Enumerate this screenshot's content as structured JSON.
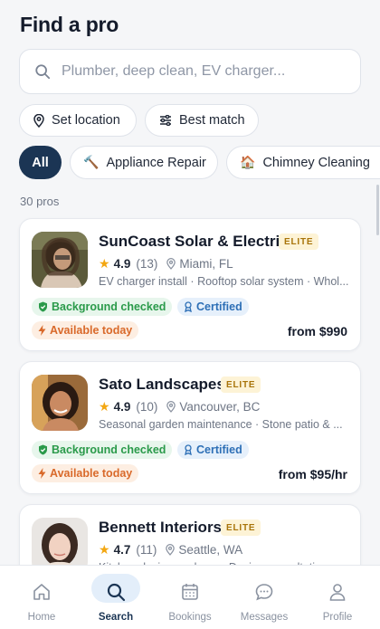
{
  "header": {
    "title": "Find a pro"
  },
  "search": {
    "placeholder": "Plumber, deep clean, EV charger..."
  },
  "filters": {
    "location_label": "Set location",
    "sort_label": "Best match"
  },
  "categories": [
    {
      "label": "All",
      "icon": "",
      "selected": true
    },
    {
      "label": "Appliance Repair",
      "icon": "hammer-icon",
      "emoji": "🔨"
    },
    {
      "label": "Chimney Cleaning",
      "icon": "house-icon",
      "emoji": "🏠"
    }
  ],
  "results": {
    "count_text": "30 pros"
  },
  "pros": [
    {
      "name": "SunCoast Solar & Electric",
      "badge": "ELITE",
      "rating": "4.9",
      "reviews": "(13)",
      "location": "Miami, FL",
      "services": "EV charger install · Rooftop solar system · Whol...",
      "badges": [
        "Background checked",
        "Certified"
      ],
      "availability": "Available today",
      "price": "from $990"
    },
    {
      "name": "Sato Landscapes",
      "badge": "ELITE",
      "rating": "4.9",
      "reviews": "(10)",
      "location": "Vancouver, BC",
      "services": "Seasonal garden maintenance · Stone patio & ...",
      "badges": [
        "Background checked",
        "Certified"
      ],
      "availability": "Available today",
      "price": "from $95/hr"
    },
    {
      "name": "Bennett Interiors",
      "badge": "ELITE",
      "rating": "4.7",
      "reviews": "(11)",
      "location": "Seattle, WA",
      "services": "Kitchen design package · Design consultation"
    }
  ],
  "nav": [
    {
      "label": "Home",
      "icon": "home-icon"
    },
    {
      "label": "Search",
      "icon": "search-icon",
      "active": true
    },
    {
      "label": "Bookings",
      "icon": "calendar-icon"
    },
    {
      "label": "Messages",
      "icon": "chat-icon"
    },
    {
      "label": "Profile",
      "icon": "user-icon"
    }
  ],
  "colors": {
    "accent": "#1b3554",
    "star": "#f3a712",
    "elite_bg": "#fdf3d6",
    "green": "#2a9a4a",
    "blue": "#2d6fb6",
    "orange": "#d9692a"
  }
}
